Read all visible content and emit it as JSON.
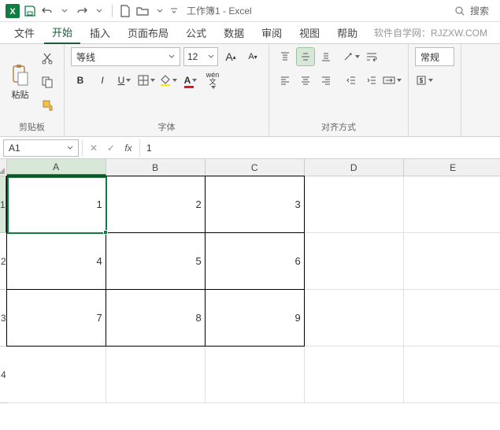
{
  "titlebar": {
    "title": "工作簿1 - Excel",
    "search_placeholder": "搜索"
  },
  "tabs": [
    "文件",
    "开始",
    "插入",
    "页面布局",
    "公式",
    "数据",
    "审阅",
    "视图",
    "帮助"
  ],
  "active_tab": 1,
  "watermark": "软件自学网：RJZXW.COM",
  "ribbon": {
    "clipboard": {
      "paste": "粘贴",
      "label": "剪贴板"
    },
    "font": {
      "name": "等线",
      "size": "12",
      "label": "字体",
      "wen": "wén"
    },
    "align": {
      "label": "对齐方式"
    },
    "number": {
      "style": "常规"
    }
  },
  "namebox": "A1",
  "formula": "1",
  "columns": [
    "A",
    "B",
    "C",
    "D",
    "E"
  ],
  "rows": [
    "1",
    "2",
    "3",
    "4"
  ],
  "cells": [
    [
      "1",
      "2",
      "3",
      "",
      ""
    ],
    [
      "4",
      "5",
      "6",
      "",
      ""
    ],
    [
      "7",
      "8",
      "9",
      "",
      ""
    ],
    [
      "",
      "",
      "",
      "",
      ""
    ]
  ],
  "colors": {
    "accent": "#107c41"
  }
}
